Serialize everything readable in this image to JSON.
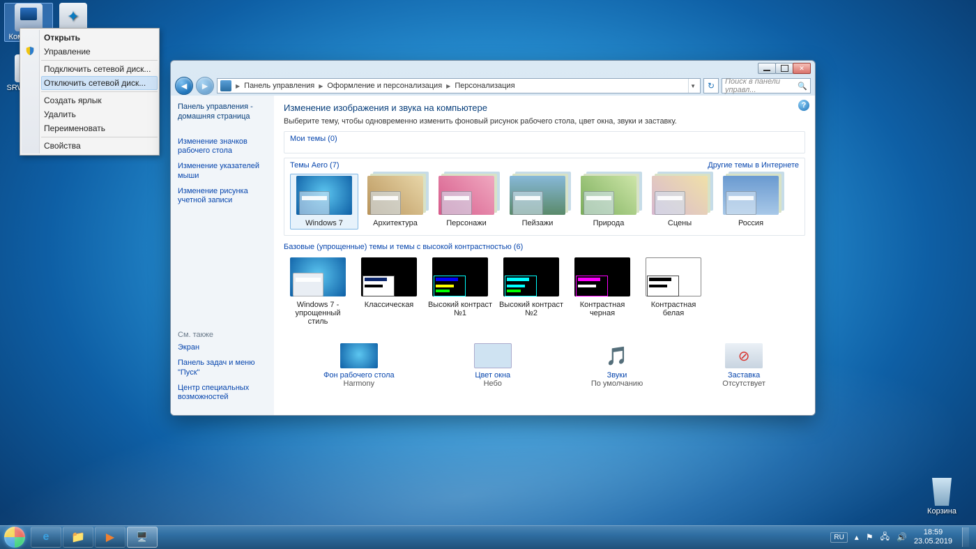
{
  "desktop": {
    "icons": {
      "computer": "Компьютер",
      "srware": "SRWare Iron",
      "recycle": "Корзина"
    }
  },
  "context_menu": {
    "open": "Открыть",
    "manage": "Управление",
    "map_drive": "Подключить сетевой диск...",
    "disconnect_drive": "Отключить сетевой диск...",
    "create_shortcut": "Создать ярлык",
    "delete": "Удалить",
    "rename": "Переименовать",
    "properties": "Свойства"
  },
  "window": {
    "breadcrumb": {
      "cp": "Панель управления",
      "appearance": "Оформление и персонализация",
      "personalization": "Персонализация"
    },
    "search_placeholder": "Поиск в панели управл...",
    "sidebar": {
      "home": "Панель управления - домашняя страница",
      "desktop_icons": "Изменение значков рабочего стола",
      "mouse_pointers": "Изменение указателей мыши",
      "account_picture": "Изменение рисунка учетной записи",
      "see_also": "См. также",
      "display": "Экран",
      "taskbar_start": "Панель задач и меню \"Пуск\"",
      "ease_of_access": "Центр специальных возможностей"
    },
    "heading": "Изменение изображения и звука на компьютере",
    "subtext": "Выберите тему, чтобы одновременно изменить фоновый рисунок рабочего стола, цвет окна, звуки и заставку.",
    "groups": {
      "my_themes": "Мои темы (0)",
      "aero": "Темы Aero (7)",
      "basic": "Базовые (упрощенные) темы и темы с высокой контрастностью (6)",
      "online_link": "Другие темы в Интернете"
    },
    "themes_aero": {
      "win7": "Windows 7",
      "arch": "Архитектура",
      "char": "Персонажи",
      "land": "Пейзажи",
      "nat": "Природа",
      "scen": "Сцены",
      "rus": "Россия"
    },
    "themes_basic": {
      "win7basic": "Windows 7 - упрощенный стиль",
      "classic": "Классическая",
      "hc1": "Высокий контраст №1",
      "hc2": "Высокий контраст №2",
      "hcblack": "Контрастная черная",
      "hcwhite": "Контрастная белая"
    },
    "bottom": {
      "bg_label": "Фон рабочего стола",
      "bg_value": "Harmony",
      "color_label": "Цвет окна",
      "color_value": "Небо",
      "sound_label": "Звуки",
      "sound_value": "По умолчанию",
      "saver_label": "Заставка",
      "saver_value": "Отсутствует"
    }
  },
  "taskbar": {
    "lang": "RU",
    "time": "18:59",
    "date": "23.05.2019"
  }
}
